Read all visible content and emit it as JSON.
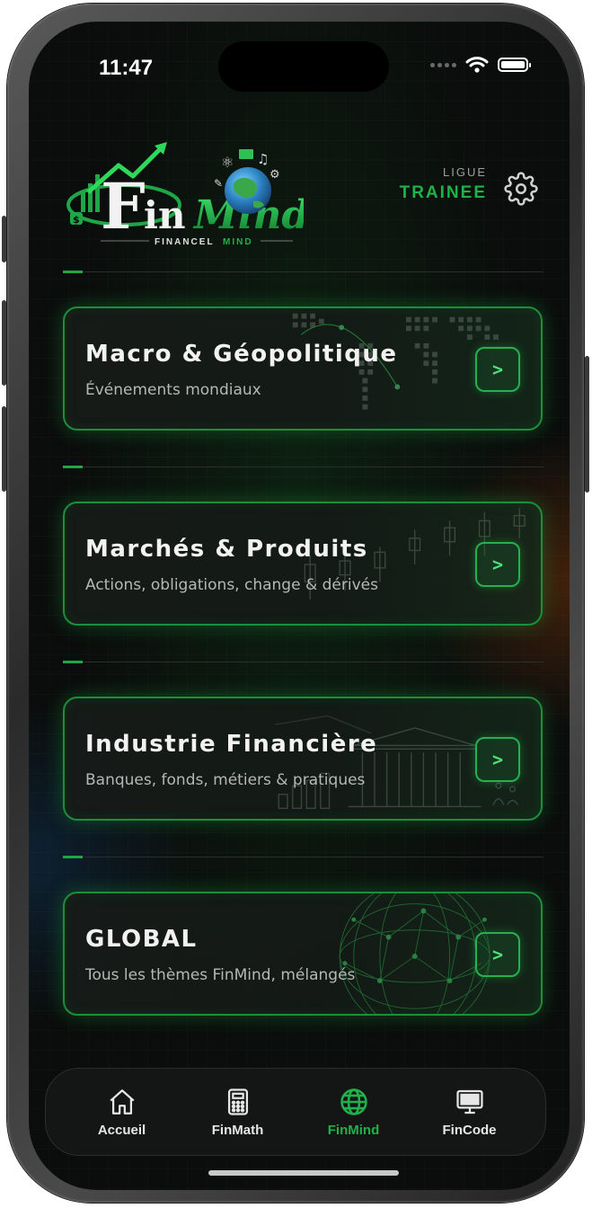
{
  "status_bar": {
    "time": "11:47"
  },
  "header": {
    "logo": {
      "brand": "FinMind",
      "tagline": "FINANCEL MIND"
    },
    "league_label": "LIGUE",
    "league_value": "TRAINEE"
  },
  "cards": [
    {
      "title": "Macro & Géopolitique",
      "subtitle": "Événements mondiaux",
      "button": ">"
    },
    {
      "title": "Marchés & Produits",
      "subtitle": "Actions, obligations, change & dérivés",
      "button": ">"
    },
    {
      "title": "Industrie Financière",
      "subtitle": "Banques, fonds, métiers & pratiques",
      "button": ">"
    },
    {
      "title": "GLOBAL",
      "subtitle": "Tous les thèmes FinMind, mélangés",
      "button": ">"
    }
  ],
  "tabbar": {
    "active": "FinMind",
    "tabs": [
      {
        "label": "Accueil",
        "icon": "home-icon"
      },
      {
        "label": "FinMath",
        "icon": "calculator-icon"
      },
      {
        "label": "FinMind",
        "icon": "globe-icon"
      },
      {
        "label": "FinCode",
        "icon": "monitor-icon"
      }
    ]
  },
  "colors": {
    "accent": "#1fb24a",
    "background": "#0b0d0c",
    "card_border": "#1c8f3c"
  }
}
